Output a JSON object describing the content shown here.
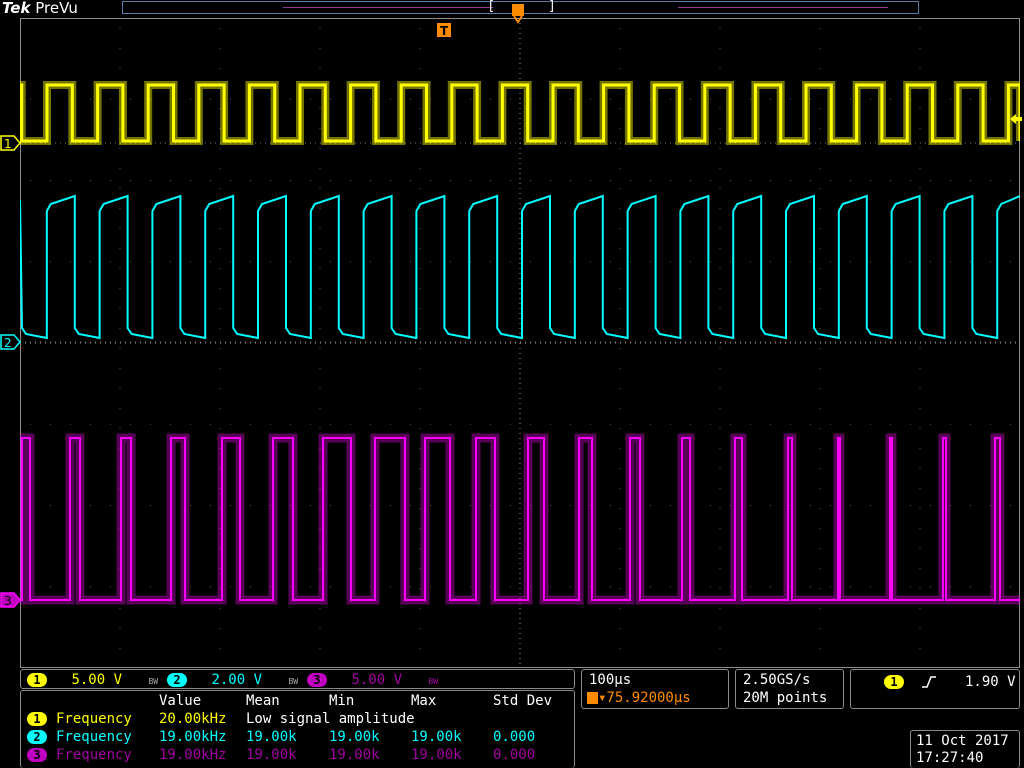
{
  "brand": {
    "tek": "Tek",
    "mode": "PreVu"
  },
  "trigger_marker": "T",
  "channel_markers": [
    "1",
    "2",
    "3"
  ],
  "colors": {
    "ch1": "#ffff00",
    "ch2": "#00ffff",
    "ch3": "#ff00ff",
    "grid": "#8c8c8c",
    "trigger": "#ff8c00"
  },
  "channels": [
    {
      "num": "1",
      "scale": "5.00 V",
      "bw": "BW"
    },
    {
      "num": "2",
      "scale": "2.00 V",
      "bw": "BW"
    },
    {
      "num": "3",
      "scale": "5.00 V",
      "bw": "BW"
    }
  ],
  "timebase": {
    "scale": "100µs",
    "delay": "▾75.92000µs"
  },
  "acquisition": {
    "rate": "2.50GS/s",
    "points": "20M points"
  },
  "trigger": {
    "channel": "1",
    "slope_icon": "rising-edge-icon",
    "level": "1.90 V"
  },
  "measurements": {
    "headers": [
      "Value",
      "Mean",
      "Min",
      "Max",
      "Std Dev"
    ],
    "rows": [
      {
        "ch": "1",
        "name": "Frequency",
        "value": "20.00kHz",
        "mean": "Low signal amplitude",
        "min": "",
        "max": "",
        "std": ""
      },
      {
        "ch": "2",
        "name": "Frequency",
        "value": "19.00kHz",
        "mean": "19.00k",
        "min": "19.00k",
        "max": "19.00k",
        "std": "0.000"
      },
      {
        "ch": "3",
        "name": "Frequency",
        "value": "19.00kHz",
        "mean": "19.00k",
        "min": "19.00k",
        "max": "19.00k",
        "std": "0.000"
      }
    ]
  },
  "datetime": {
    "date": "11 Oct  2017",
    "time": "17:27:40"
  }
}
